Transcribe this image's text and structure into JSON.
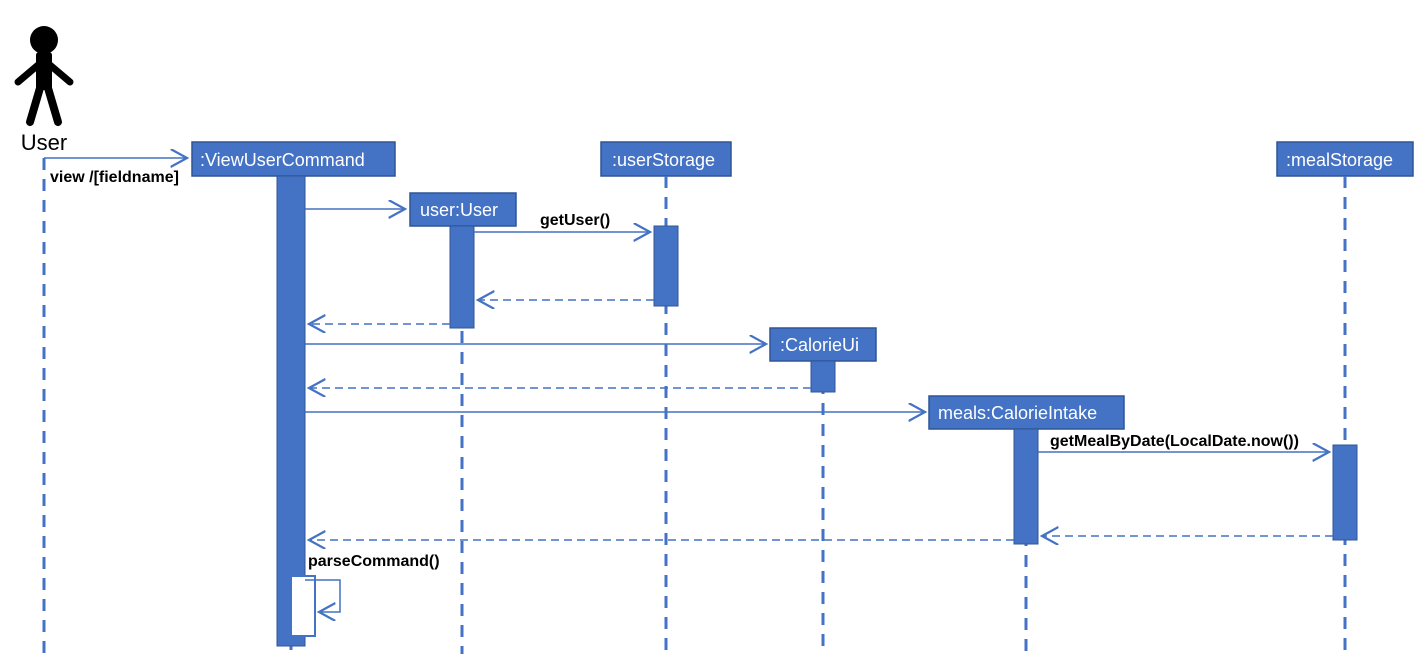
{
  "actor": {
    "label": "User"
  },
  "participants": {
    "viewUserCommand": ":ViewUserCommand",
    "userUser": "user:User",
    "userStorage": ":userStorage",
    "calorieUi": ":CalorieUi",
    "mealsCalorieIntake": "meals:CalorieIntake",
    "mealStorage": ":mealStorage"
  },
  "messages": {
    "viewFieldname": "view /[fieldname]",
    "getUser": "getUser()",
    "getMealByDate": "getMealByDate(LocalDate.now())",
    "parseCommand": "parseCommand()"
  }
}
